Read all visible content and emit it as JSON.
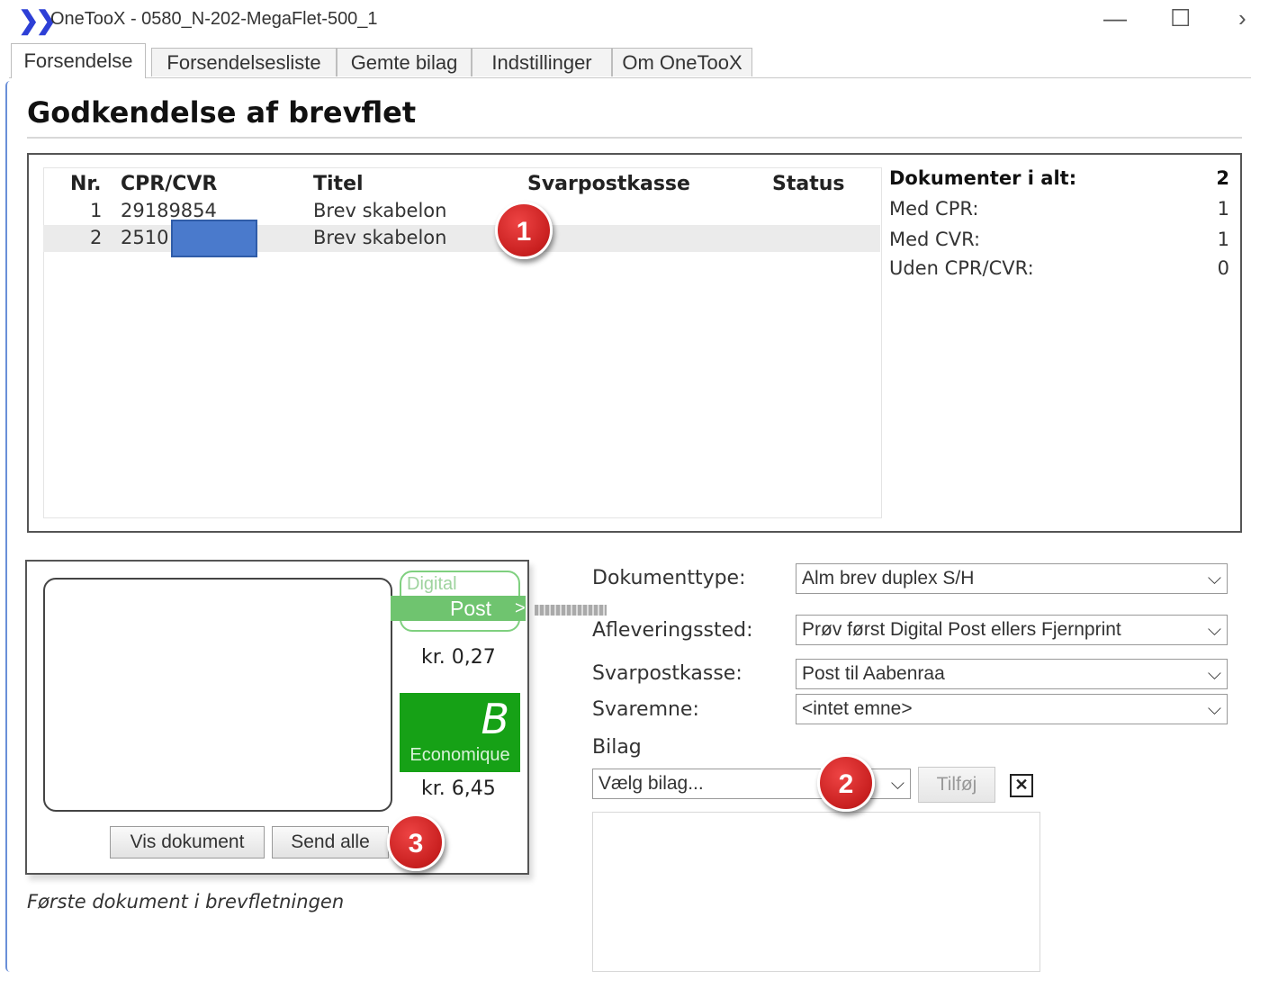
{
  "window": {
    "logo_glyph": "❯❯",
    "title": "OneTooX - 0580_N-202-MegaFlet-500_1",
    "minimize_glyph": "—",
    "maximize_glyph": "☐",
    "close_glyph": "›"
  },
  "tabs": [
    {
      "label": "Forsendelse"
    },
    {
      "label": "Forsendelsesliste"
    },
    {
      "label": "Gemte bilag"
    },
    {
      "label": "Indstillinger"
    },
    {
      "label": "Om OneTooX"
    }
  ],
  "page_title": "Godkendelse af brevflet",
  "table": {
    "headers": {
      "nr": "Nr.",
      "cpr": "CPR/CVR",
      "titel": "Titel",
      "svarpostkasse": "Svarpostkasse",
      "status": "Status"
    },
    "rows": [
      {
        "nr": "1",
        "cpr": "29189854",
        "titel": "Brev skabelon",
        "svarpostkasse": "",
        "status": ""
      },
      {
        "nr": "2",
        "cpr": "2510",
        "titel": "Brev skabelon",
        "svarpostkasse": "",
        "status": ""
      }
    ]
  },
  "stats": {
    "total_label": "Dokumenter i alt:",
    "total_value": "2",
    "cpr_label": "Med CPR:",
    "cpr_value": "1",
    "cvr_label": "Med CVR:",
    "cvr_value": "1",
    "none_label": "Uden CPR/CVR:",
    "none_value": "0"
  },
  "callouts": [
    "1",
    "2",
    "3"
  ],
  "preview": {
    "digital_label": "Digital",
    "post_label": "Post",
    "post_arrow": ">",
    "digital_price": "kr. 0,27",
    "b_letter": "B",
    "b_label": "Economique",
    "b_price": "kr. 6,45",
    "vis_dokument": "Vis dokument",
    "send_alle": "Send alle",
    "note": "Første dokument i brevfletningen"
  },
  "form": {
    "dokumenttype_label": "Dokumenttype:",
    "dokumenttype_value": "Alm brev duplex S/H",
    "afleveringssted_label": "Afleveringssted:",
    "afleveringssted_value": "Prøv først Digital Post ellers Fjernprint",
    "svarpostkasse_label": "Svarpostkasse:",
    "svarpostkasse_value": "Post til Aabenraa",
    "svaremne_label": "Svaremne:",
    "svaremne_value": "<intet emne>",
    "bilag_label": "Bilag",
    "bilag_placeholder": "Vælg bilag...",
    "tilfoj_label": "Tilføj",
    "chevron_glyph": "⌵",
    "remove_glyph": "✕"
  }
}
